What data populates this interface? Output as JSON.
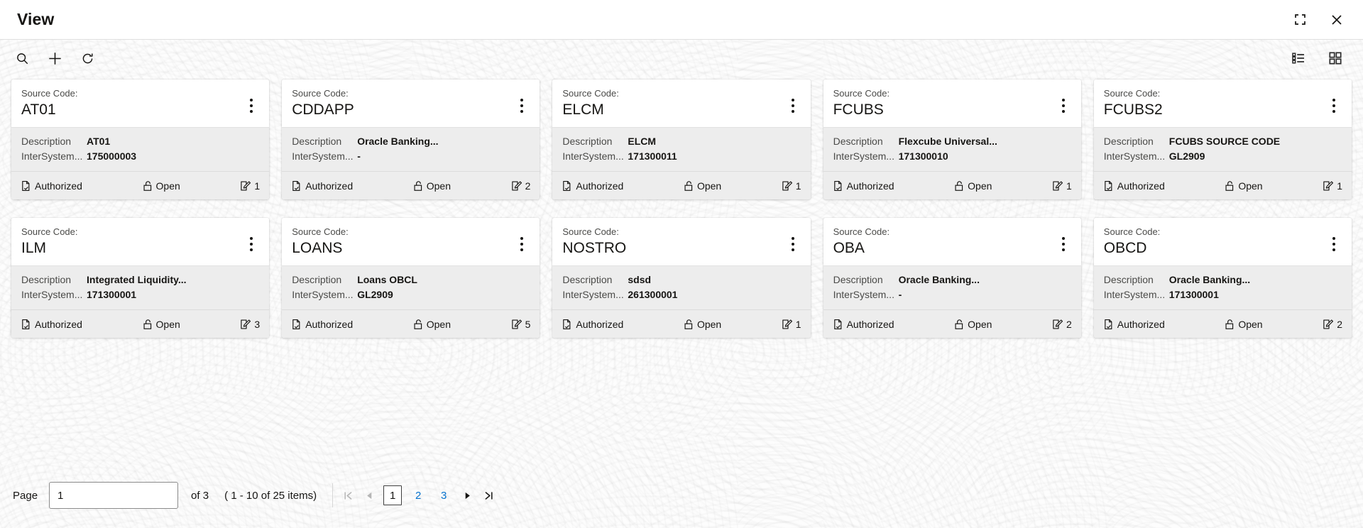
{
  "window": {
    "title": "View",
    "restore_icon": "collapse-icon",
    "close_icon": "close-icon"
  },
  "toolbar": {
    "search_icon": "search-icon",
    "add_icon": "plus-icon",
    "refresh_icon": "refresh-icon",
    "list_view_icon": "list-view-icon",
    "grid_view_icon": "grid-view-icon"
  },
  "card_meta": {
    "source_code_label": "Source Code:",
    "description_key": "Description",
    "intersystem_key": "InterSystem...",
    "menu_icon": "kebab-menu-icon",
    "auth_icon": "document-check-icon",
    "lock_icon": "unlock-icon",
    "edit_icon": "edit-square-icon"
  },
  "cards": [
    {
      "source_code": "AT01",
      "description": "AT01",
      "intersystem": "175000003",
      "status": "Authorized",
      "lock_state": "Open",
      "modifications": "1"
    },
    {
      "source_code": "CDDAPP",
      "description": "Oracle Banking...",
      "intersystem": "-",
      "status": "Authorized",
      "lock_state": "Open",
      "modifications": "2"
    },
    {
      "source_code": "ELCM",
      "description": "ELCM",
      "intersystem": "171300011",
      "status": "Authorized",
      "lock_state": "Open",
      "modifications": "1"
    },
    {
      "source_code": "FCUBS",
      "description": "Flexcube Universal...",
      "intersystem": "171300010",
      "status": "Authorized",
      "lock_state": "Open",
      "modifications": "1"
    },
    {
      "source_code": "FCUBS2",
      "description": "FCUBS SOURCE CODE",
      "intersystem": "GL2909",
      "status": "Authorized",
      "lock_state": "Open",
      "modifications": "1"
    },
    {
      "source_code": "ILM",
      "description": "Integrated Liquidity...",
      "intersystem": "171300001",
      "status": "Authorized",
      "lock_state": "Open",
      "modifications": "3"
    },
    {
      "source_code": "LOANS",
      "description": "Loans OBCL",
      "intersystem": "GL2909",
      "status": "Authorized",
      "lock_state": "Open",
      "modifications": "5"
    },
    {
      "source_code": "NOSTRO",
      "description": "sdsd",
      "intersystem": "261300001",
      "status": "Authorized",
      "lock_state": "Open",
      "modifications": "1"
    },
    {
      "source_code": "OBA",
      "description": "Oracle Banking...",
      "intersystem": "-",
      "status": "Authorized",
      "lock_state": "Open",
      "modifications": "2"
    },
    {
      "source_code": "OBCD",
      "description": "Oracle Banking...",
      "intersystem": "171300001",
      "status": "Authorized",
      "lock_state": "Open",
      "modifications": "2"
    }
  ],
  "pagination": {
    "page_label": "Page",
    "page_value": "1",
    "page_placeholder": "",
    "of_text": "of 3",
    "items_text": "( 1 - 10 of 25 items)",
    "first_icon": "first-page-icon",
    "prev_icon": "previous-page-icon",
    "next_icon": "next-page-icon",
    "last_icon": "last-page-icon",
    "pages": [
      "1",
      "2",
      "3"
    ],
    "active_page": "1"
  },
  "colors": {
    "link_blue": "#0572ce",
    "text_dark": "#161513",
    "text_muted": "#4a4a48",
    "card_body_gray": "#ededed",
    "disabled_gray": "#b5b5b5"
  }
}
